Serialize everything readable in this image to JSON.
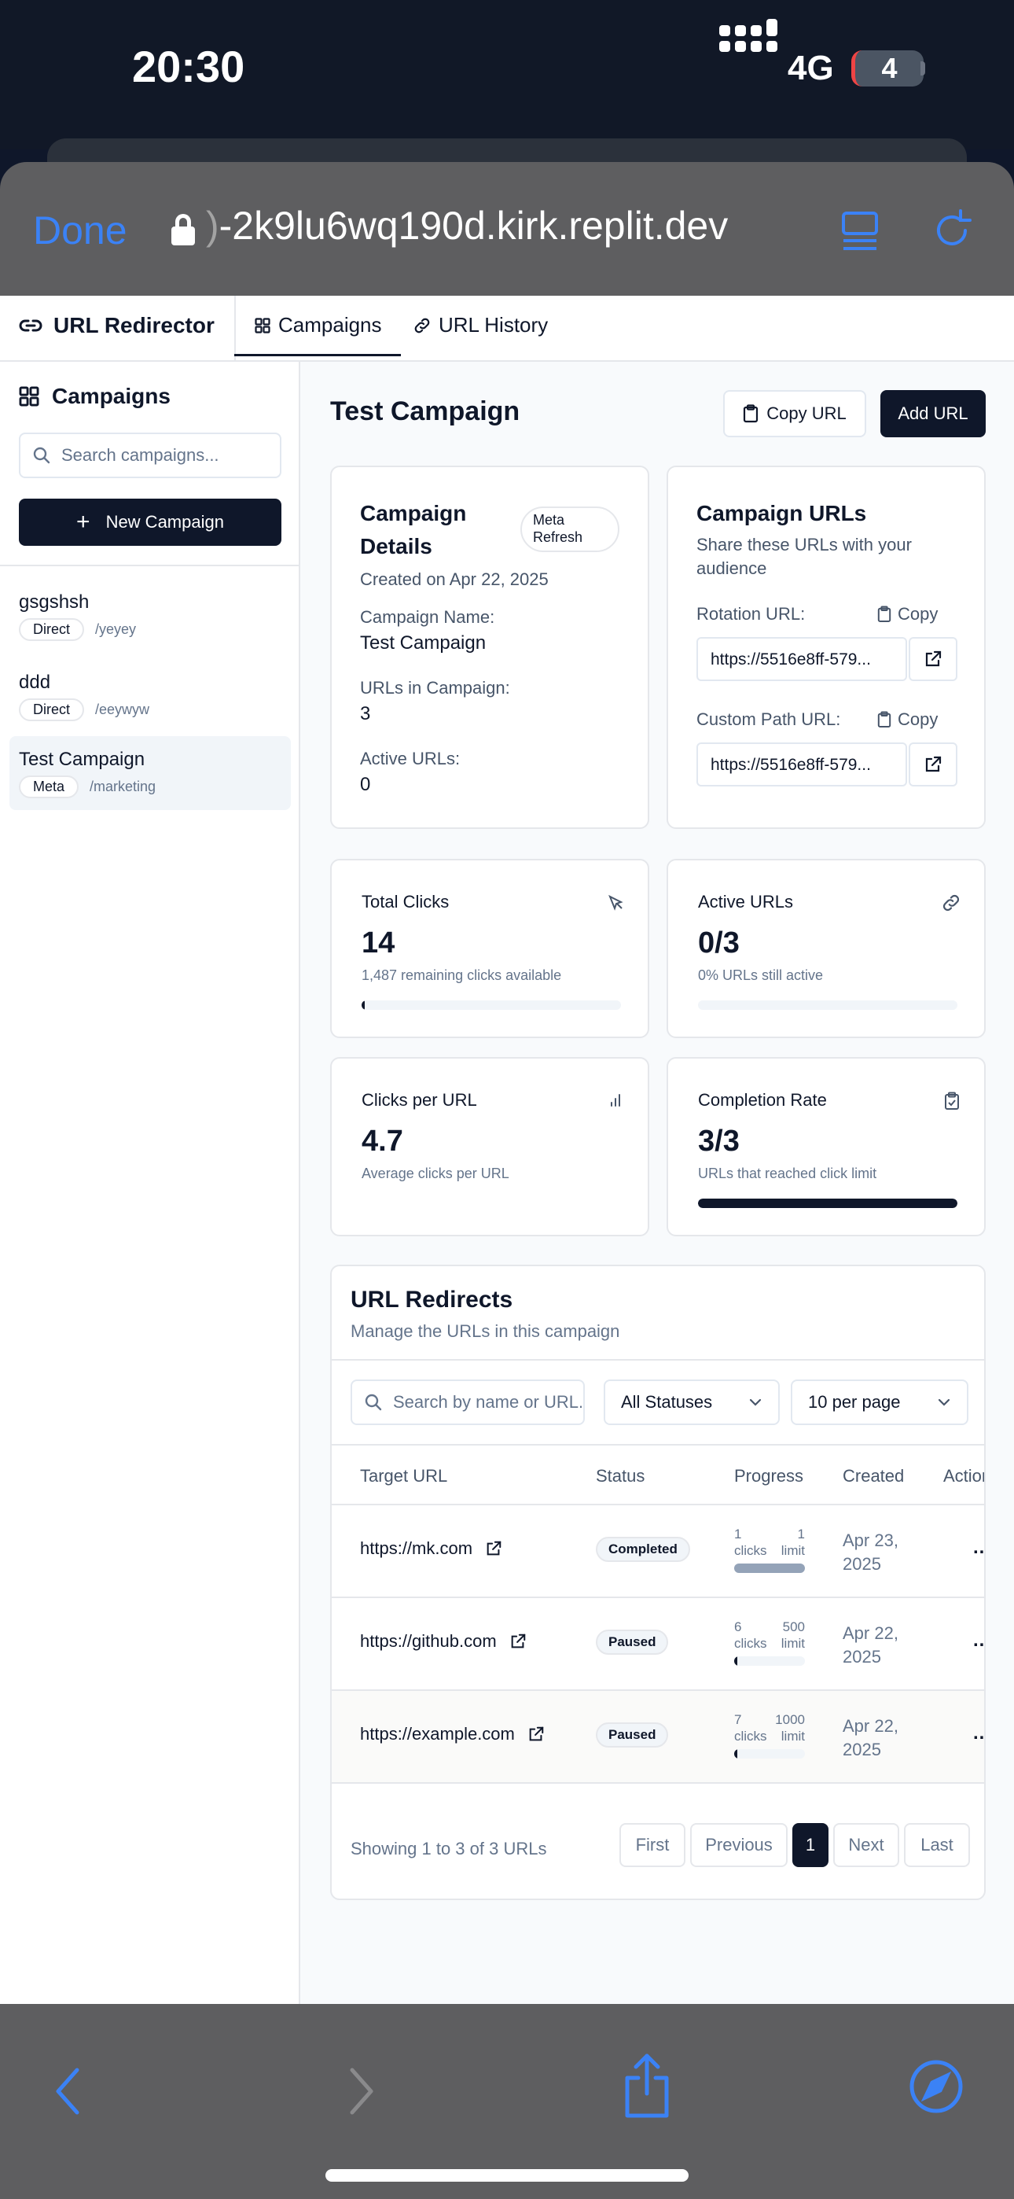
{
  "status_bar": {
    "time": "20:30",
    "network": "4G",
    "battery": "4"
  },
  "browser": {
    "done_label": "Done",
    "url_prefix": ")",
    "url_main": "-2k9lu6wq190d.kirk.replit.dev"
  },
  "app": {
    "brand": "URL Redirector",
    "tabs": [
      {
        "label": "Campaigns"
      },
      {
        "label": "URL History"
      }
    ]
  },
  "sidebar": {
    "title": "Campaigns",
    "search_placeholder": "Search campaigns...",
    "new_button": "New Campaign",
    "campaigns": [
      {
        "name": "gsgshsh",
        "type": "Direct",
        "path": "/yeyey"
      },
      {
        "name": "ddd",
        "type": "Direct",
        "path": "/eeywyw"
      },
      {
        "name": "Test Campaign",
        "type": "Meta",
        "path": "/marketing"
      }
    ]
  },
  "main": {
    "title": "Test Campaign",
    "copy_url_button": "Copy URL",
    "add_url_button": "Add URL",
    "details": {
      "title": "Campaign Details",
      "badge": "Meta Refresh",
      "created": "Created on Apr 22, 2025",
      "name_label": "Campaign Name:",
      "name_value": "Test Campaign",
      "urls_label": "URLs in Campaign:",
      "urls_value": "3",
      "active_label": "Active URLs:",
      "active_value": "0"
    },
    "campaign_urls": {
      "title": "Campaign URLs",
      "subtitle": "Share these URLs with your audience",
      "rotation_label": "Rotation URL:",
      "rotation_value": "https://5516e8ff-579...",
      "custom_label": "Custom Path URL:",
      "custom_value": "https://5516e8ff-579...",
      "copy_label": "Copy"
    },
    "stats": {
      "total_clicks": {
        "label": "Total Clicks",
        "value": "14",
        "sub": "1,487 remaining clicks available",
        "progress": 0.009
      },
      "active_urls": {
        "label": "Active URLs",
        "value": "0/3",
        "sub": "0% URLs still active",
        "progress": 0
      },
      "clicks_per_url": {
        "label": "Clicks per URL",
        "value": "4.7",
        "sub": "Average clicks per URL"
      },
      "completion_rate": {
        "label": "Completion Rate",
        "value": "3/3",
        "sub": "URLs that reached click limit",
        "progress": 1
      }
    },
    "redirects": {
      "title": "URL Redirects",
      "subtitle": "Manage the URLs in this campaign",
      "search_placeholder": "Search by name or URL...",
      "status_filter": "All Statuses",
      "per_page": "10 per page",
      "columns": [
        "Target URL",
        "Status",
        "Progress",
        "Created",
        "Actions"
      ],
      "rows": [
        {
          "url": "https://mk.com",
          "status": "Completed",
          "clicks": "1",
          "clicks_unit": "clicks",
          "limit": "1",
          "limit_unit": "limit",
          "progress": 1,
          "created_1": "Apr 23,",
          "created_2": "2025"
        },
        {
          "url": "https://github.com",
          "status": "Paused",
          "clicks": "6",
          "clicks_unit": "clicks",
          "limit": "500",
          "limit_unit": "limit",
          "progress": 0.012,
          "created_1": "Apr 22,",
          "created_2": "2025"
        },
        {
          "url": "https://example.com",
          "status": "Paused",
          "clicks": "7",
          "clicks_unit": "clicks",
          "limit": "1000",
          "limit_unit": "limit",
          "progress": 0.007,
          "created_1": "Apr 22,",
          "created_2": "2025"
        }
      ],
      "row_actions": "...",
      "showing": "Showing 1 to 3 of 3 URLs",
      "pagination": {
        "first": "First",
        "previous": "Previous",
        "current": "1",
        "next": "Next",
        "last": "Last"
      }
    }
  },
  "colors": {
    "accent": "#3b82f6",
    "primary": "#0f172a",
    "muted": "#64748b",
    "border": "#e5e7eb"
  }
}
